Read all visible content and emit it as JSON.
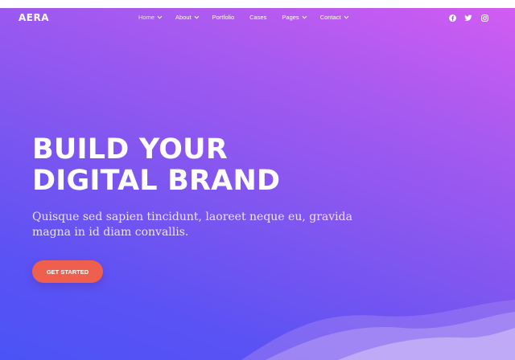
{
  "brand": {
    "logo": "AERA"
  },
  "nav": {
    "items": [
      {
        "label": "Home",
        "dropdown": true,
        "active": true
      },
      {
        "label": "About",
        "dropdown": true,
        "active": false
      },
      {
        "label": "Portfolio",
        "dropdown": false,
        "active": false
      },
      {
        "label": "Cases",
        "dropdown": false,
        "active": false
      },
      {
        "label": "Pages",
        "dropdown": true,
        "active": false
      },
      {
        "label": "Contact",
        "dropdown": true,
        "active": false
      }
    ],
    "social": [
      {
        "icon": "facebook-icon"
      },
      {
        "icon": "twitter-icon"
      },
      {
        "icon": "instagram-icon"
      }
    ]
  },
  "hero": {
    "headline_line1": "BUILD YOUR",
    "headline_line2": "DIGITAL BRAND",
    "subtext": "Quisque sed sapien tincidunt, laoreet neque eu, gravida magna in id diam convallis.",
    "cta_label": "GET STARTED"
  },
  "colors": {
    "gradient_top_right": "#d25cf2",
    "gradient_bottom_left": "#4b53f6",
    "cta": "#ee5f4d",
    "text": "#ffffff"
  }
}
